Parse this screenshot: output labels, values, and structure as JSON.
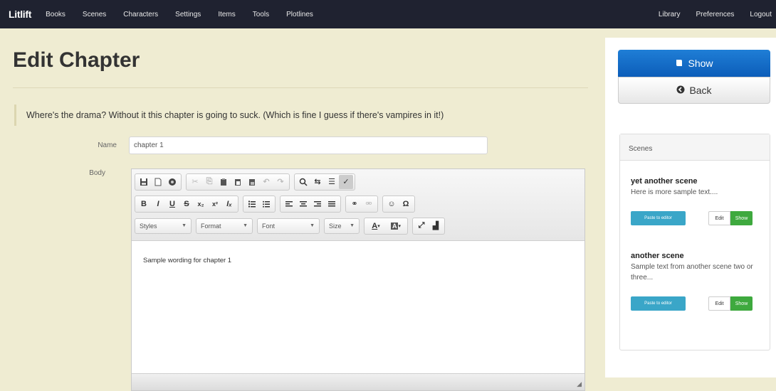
{
  "nav": {
    "brand": "Litlift",
    "left_items": [
      "Books",
      "Scenes",
      "Characters",
      "Settings",
      "Items",
      "Tools",
      "Plotlines"
    ],
    "right_items": [
      "Library",
      "Preferences",
      "Logout"
    ]
  },
  "page": {
    "title": "Edit Chapter",
    "quote": "Where's the drama? Without it this chapter is going to suck. (Which is fine I guess if there's vampires in it!)"
  },
  "form": {
    "name_label": "Name",
    "name_value": "chapter 1",
    "body_label": "Body",
    "body_text": "Sample wording for chapter 1"
  },
  "editor": {
    "combos": {
      "styles": "Styles",
      "format": "Format",
      "font": "Font",
      "size": "Size"
    },
    "row2_glyphs": {
      "bold": "B",
      "italic": "I",
      "underline": "U",
      "strike": "S",
      "subscript": "x₂",
      "superscript": "x²",
      "remove_format": "Iₓ"
    }
  },
  "sidebar": {
    "show_label": "Show",
    "back_label": "Back",
    "scenes_heading": "Scenes",
    "scenes": [
      {
        "title": "yet another scene",
        "text": "Here is more sample text....",
        "paste_label": "Paste to editor",
        "edit_label": "Edit",
        "show_label": "Show"
      },
      {
        "title": "another scene",
        "text": "Sample text from another scene two or three...",
        "paste_label": "Paste to editor",
        "edit_label": "Edit",
        "show_label": "Show"
      }
    ]
  },
  "colors": {
    "navbar": "#1f2230",
    "page_bg": "#efecd2",
    "primary": "#0c5db9",
    "info": "#3aa6c8",
    "success": "#3ea93e"
  }
}
